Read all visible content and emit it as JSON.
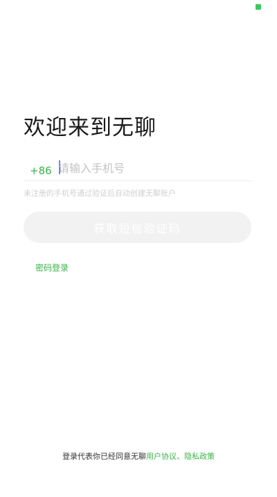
{
  "colors": {
    "accent": "#38b44a",
    "status_indicator": "#3cc95c"
  },
  "status_bar": {
    "indicator_icon": "status-square-icon"
  },
  "welcome": {
    "title": "欢迎来到无聊"
  },
  "phone_form": {
    "country_code": "+86",
    "phone_placeholder": "请输入手机号",
    "phone_value": "",
    "hint": "未注册的手机号通过验证后自动创建无聊账户"
  },
  "sms_button": {
    "label": "获取短信验证码"
  },
  "password_login": {
    "label": "密码登录"
  },
  "footer": {
    "prefix": "登录代表你已经同意无聊",
    "user_agreement": "用户协议",
    "separator": "、",
    "privacy_policy": "隐私政策"
  }
}
